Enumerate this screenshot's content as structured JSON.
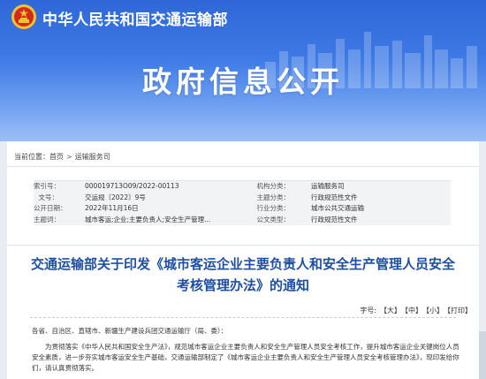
{
  "header": {
    "ministry_name": "中华人民共和国交通运输部",
    "banner_title": "政府信息公开",
    "emblem_icon": "national-emblem-icon",
    "colors": {
      "banner_top": "#2f67d8",
      "banner_bottom": "#86b0f4",
      "title_blue": "#1f4fa0",
      "emblem_red": "#d22a1e",
      "emblem_gold": "#f2c230"
    }
  },
  "breadcrumb": {
    "label": "当前位置：",
    "items": [
      "首页",
      "运输服务司"
    ],
    "separator": ">"
  },
  "metadata": {
    "rows": [
      {
        "l1": "索引号：",
        "v1": "000019713O09/2022-00113",
        "l2": "机构分类：",
        "v2": "运输服务司"
      },
      {
        "l1": "文号：",
        "v1": "交运规〔2022〕9号",
        "l2": "主题分类：",
        "v2": "行政规范性文件"
      },
      {
        "l1": "公开日期：",
        "v1": "2022年11月16日",
        "l2": "行业分类：",
        "v2": "城市公共交通运输"
      },
      {
        "l1": "主题词：",
        "v1": "城市客运;企业;主要负责人;安全生产管理...",
        "l2": "公文类型：",
        "v2": "行政规范性文件"
      }
    ]
  },
  "document": {
    "title": "交通运输部关于印发《城市客运企业主要负责人和安全生产管理人员安全考核管理办法》的通知"
  },
  "font_size_controls": {
    "label": "字号:",
    "large": "【大】",
    "medium": "【中】",
    "small": "【小】",
    "print": "【打印】"
  },
  "body": {
    "recipients": "各省、自治区、直辖市、新疆生产建设兵团交通运输厅（局、委）：",
    "paragraph": "为贯彻落实《中华人民共和国安全生产法》，规范城市客运企业主要负责人和安全生产管理人员安全考核工作，提升城市客运企业关键岗位人员安全素质，进一步夯实城市客运安全生产基础，交通运输部制定了《城市客运企业主要负责人和安全生产管理人员安全考核管理办法》，现印发给你们，请认真贯彻落实。"
  }
}
